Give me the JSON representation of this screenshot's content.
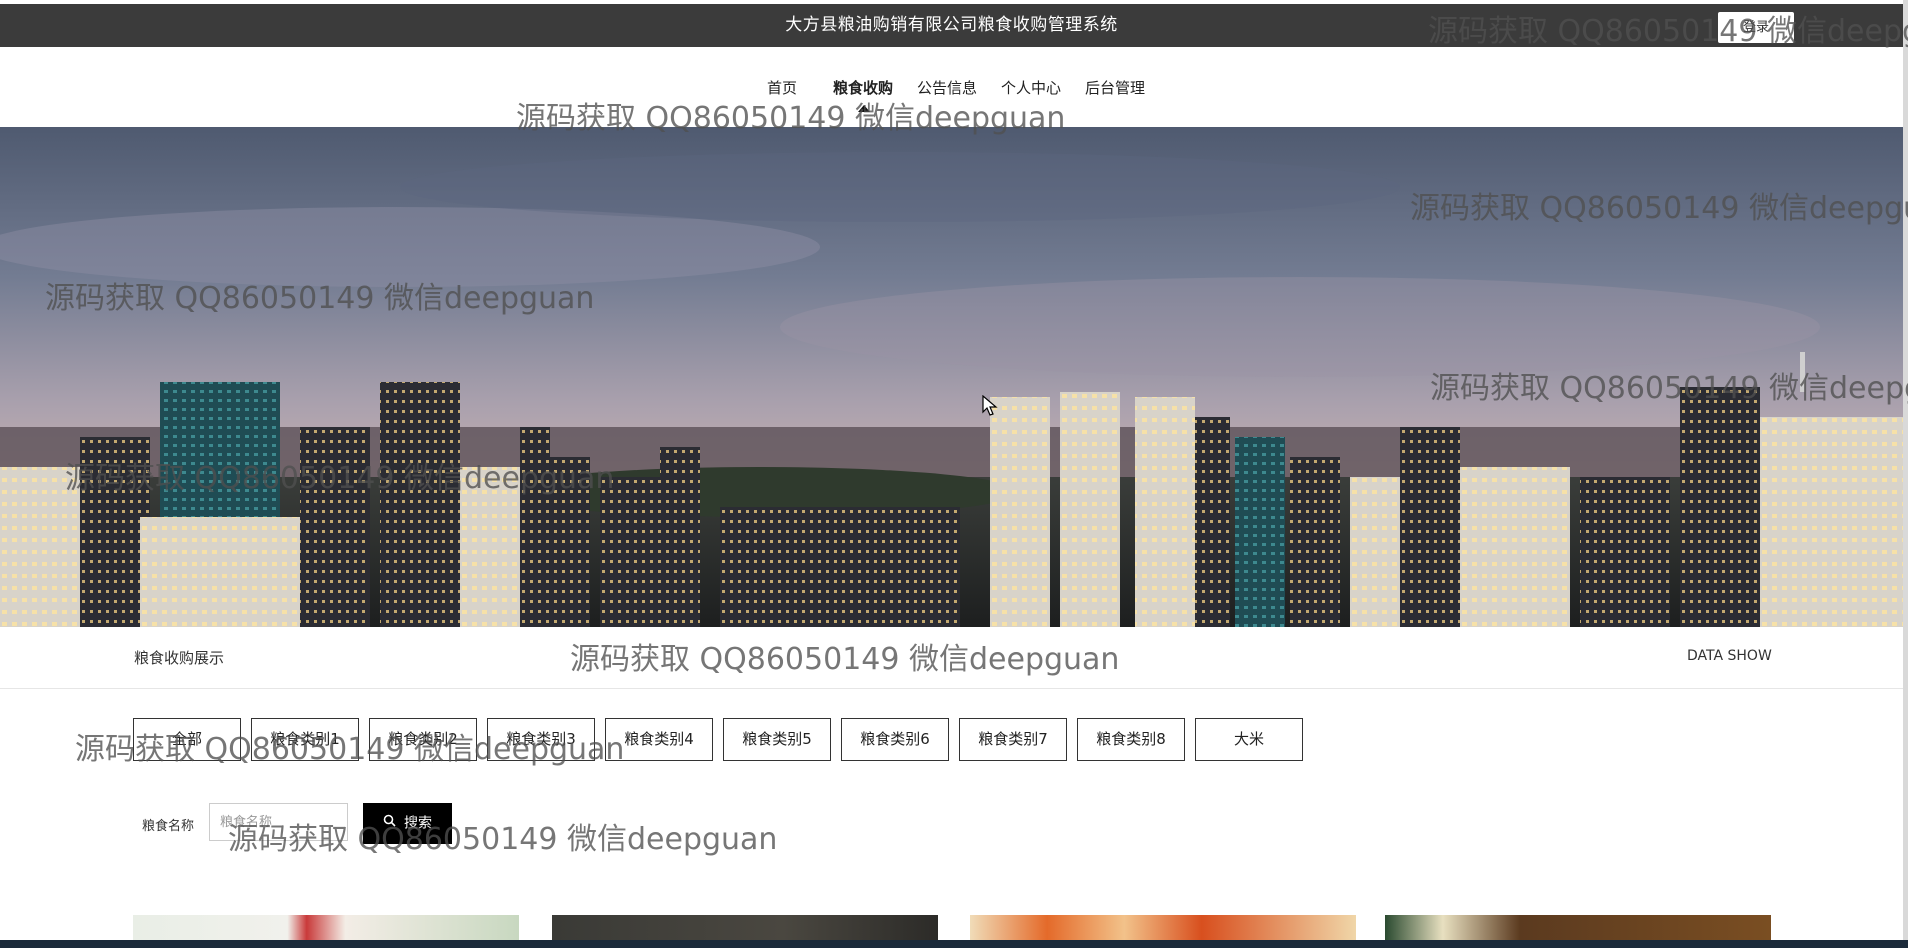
{
  "header": {
    "title": "大方县粮油购销有限公司粮食收购管理系统",
    "login_label": "登录"
  },
  "nav": {
    "items": [
      {
        "label": "首页"
      },
      {
        "label": "粮食收购",
        "active": true
      },
      {
        "label": "公告信息"
      },
      {
        "label": "个人中心"
      },
      {
        "label": "后台管理"
      }
    ]
  },
  "section": {
    "title": "粮食收购展示",
    "subtitle": "DATA SHOW"
  },
  "categories": [
    "全部",
    "粮食类别1",
    "粮食类别2",
    "粮食类别3",
    "粮食类别4",
    "粮食类别5",
    "粮食类别6",
    "粮食类别7",
    "粮食类别8",
    "大米"
  ],
  "search": {
    "label": "粮食名称",
    "placeholder": "粮食名称",
    "button_label": "搜索"
  },
  "watermark": "源码获取 QQ86050149 微信deepguan",
  "colors": {
    "topbar": "#3b3b3b",
    "search_button": "#000000",
    "taskbar": "#1b2a3a"
  }
}
